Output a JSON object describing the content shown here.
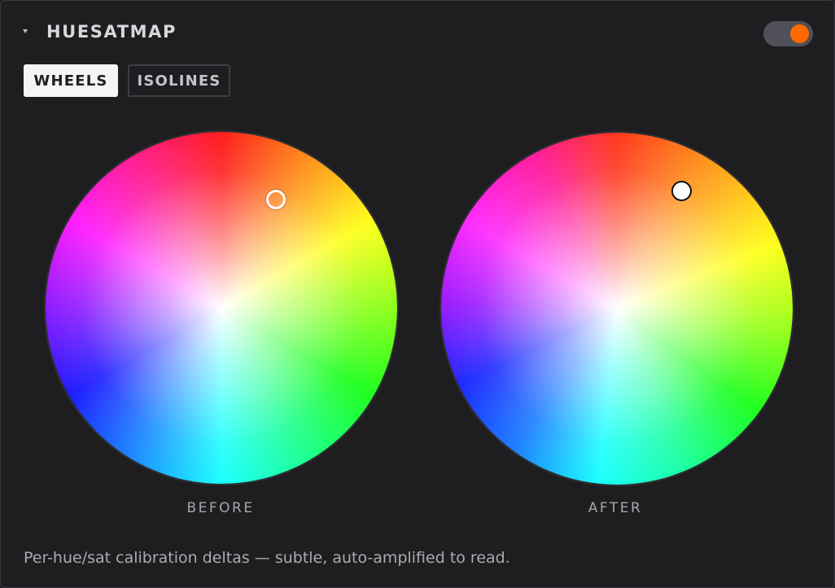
{
  "panel": {
    "title": "HUESATMAP",
    "enabled": true,
    "accent_color": "#ff6a00"
  },
  "icons": {
    "collapse": "caret-down-icon"
  },
  "tabs": [
    {
      "label": "WHEELS",
      "active": true
    },
    {
      "label": "ISOLINES",
      "active": false
    }
  ],
  "wheels": {
    "before_label": "BEFORE",
    "after_label": "AFTER"
  },
  "footnote": "Per-hue/sat calibration deltas — subtle, auto-amplified to read."
}
